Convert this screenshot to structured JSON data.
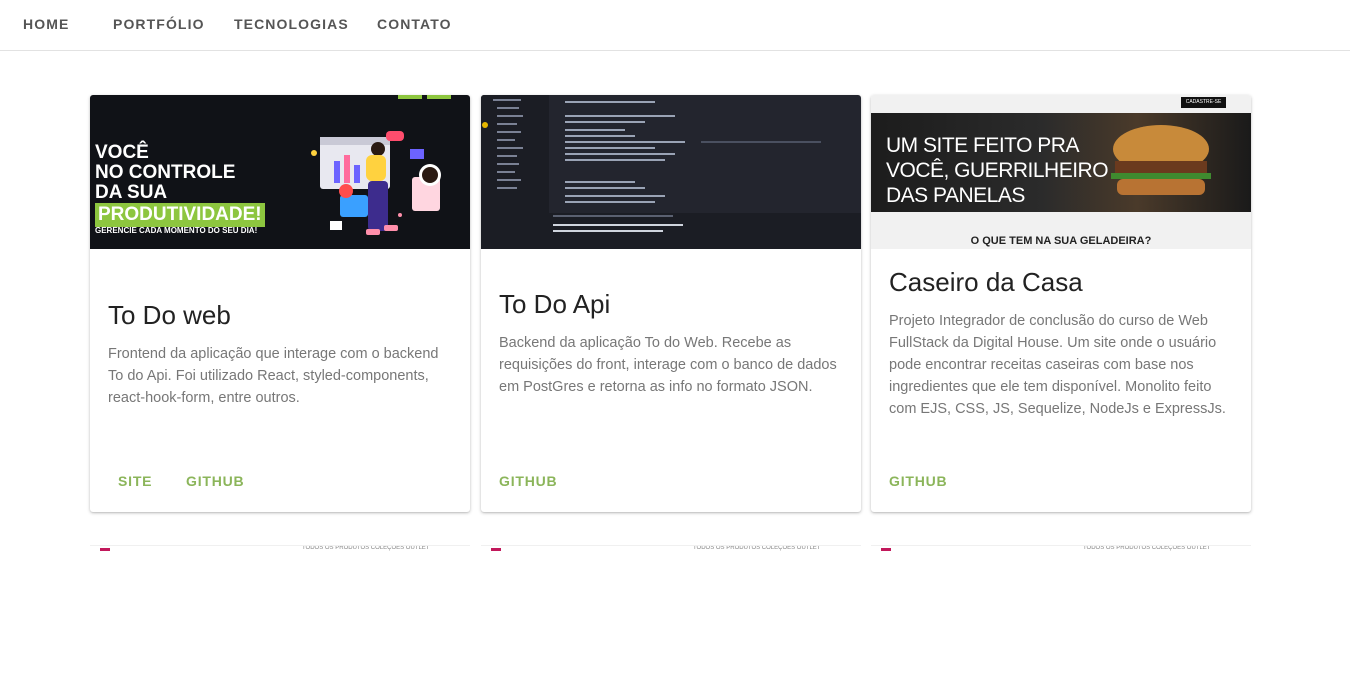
{
  "nav": {
    "items": [
      {
        "label": "HOME"
      },
      {
        "label": "PORTFÓLIO"
      },
      {
        "label": "TECNOLOGIAS"
      },
      {
        "label": "CONTATO"
      }
    ]
  },
  "cards": [
    {
      "title": "To Do web",
      "description": "Frontend da aplicação que interage com o backend To do Api. Foi utilizado React, styled-components, react-hook-form, entre outros.",
      "media": {
        "headline_lines": [
          "VOCÊ",
          "NO CONTROLE",
          "DA SUA"
        ],
        "highlight": "PRODUTIVIDADE!",
        "tagline": "GERENCIE CADA MOMENTO DO SEU DIA!"
      },
      "actions": [
        {
          "label": "SITE"
        },
        {
          "label": "GITHUB"
        }
      ]
    },
    {
      "title": "To Do Api",
      "description": "Backend da aplicação To do Web. Recebe as requisições do front, interage com o banco de dados em PostGres e retorna as info no formato JSON.",
      "actions": [
        {
          "label": "GITHUB"
        }
      ]
    },
    {
      "title": "Caseiro da Casa",
      "description": "Projeto Integrador de conclusão do curso de Web FullStack da Digital House. Um site onde o usuário pode encontrar receitas caseiras com base nos ingredientes que ele tem disponível. Monolito feito com EJS, CSS, JS, Sequelize, NodeJs e ExpressJs.",
      "media": {
        "hero_lines": [
          "UM SITE FEITO PRA",
          "VOCÊ, GUERRILHEIRO",
          "DAS PANELAS"
        ],
        "question": "O QUE TEM NA SUA GELADEIRA?",
        "signup_label": "CADASTRE-SE"
      },
      "actions": [
        {
          "label": "GITHUB"
        }
      ]
    }
  ],
  "peek_cards": [
    {
      "links": "TODOS OS PRODUTOS  COLEÇOES  OUTLET"
    },
    {
      "links": "TODOS OS PRODUTOS  COLEÇOES  OUTLET"
    },
    {
      "links": "TODOS OS PRODUTOS  COLEÇOES  OUTLET"
    }
  ],
  "colors": {
    "accent": "#8bb55a",
    "nav_text": "#555555"
  }
}
